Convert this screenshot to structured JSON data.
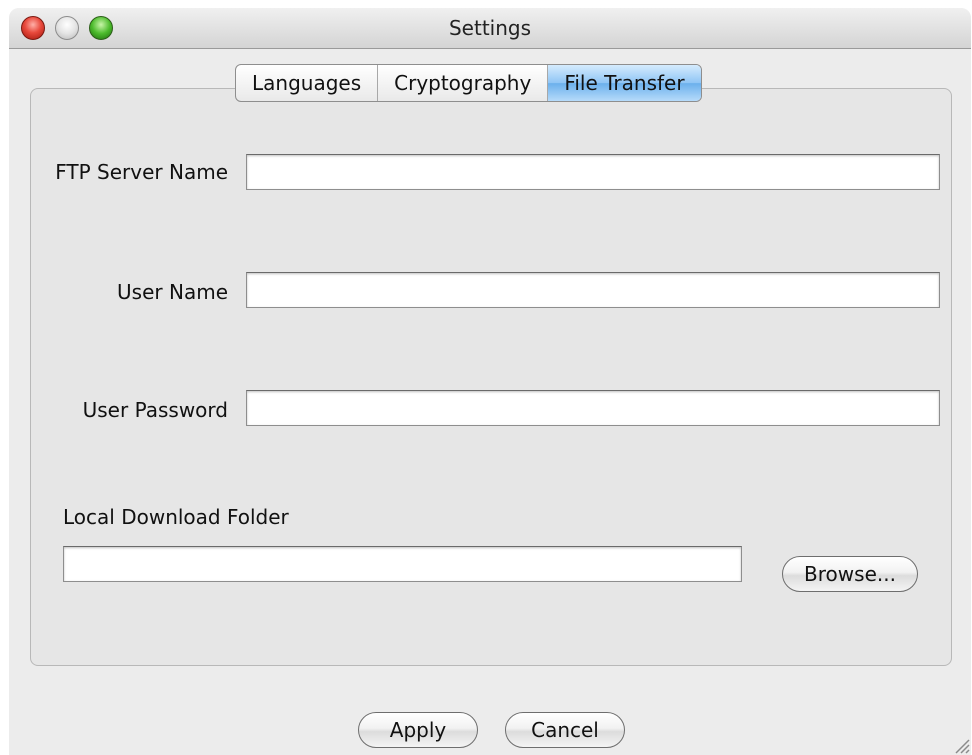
{
  "window": {
    "title": "Settings"
  },
  "tabs": [
    {
      "label": "Languages",
      "active": false
    },
    {
      "label": "Cryptography",
      "active": false
    },
    {
      "label": "File Transfer",
      "active": true
    }
  ],
  "form": {
    "ftp_server_name": {
      "label": "FTP Server Name",
      "value": ""
    },
    "user_name": {
      "label": "User Name",
      "value": ""
    },
    "user_password": {
      "label": "User Password",
      "value": ""
    },
    "local_download_folder": {
      "label": "Local Download Folder",
      "value": ""
    },
    "browse_label": "Browse..."
  },
  "footer": {
    "apply_label": "Apply",
    "cancel_label": "Cancel"
  },
  "icons": {
    "close": "close-icon",
    "minimize": "minimize-icon",
    "zoom": "zoom-icon",
    "resize_grip": "resize-grip-icon"
  },
  "colors": {
    "active_tab": "#8fc5f5",
    "close_button": "#e8493c",
    "zoom_button": "#4cbb2c"
  }
}
